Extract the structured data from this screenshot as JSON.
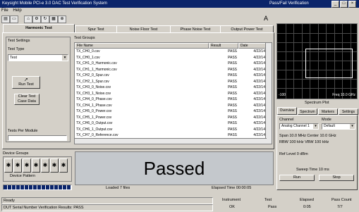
{
  "window": {
    "title": "Keysight Mobile PCI-e 3.0 DAC Test Verification System",
    "right_title": "Pass/Fail Verification"
  },
  "menu": {
    "items": [
      "File",
      "Help"
    ]
  },
  "tabs": [
    "Harmonic Test",
    "Spur Test",
    "Noise Floor Test",
    "Phase Noise Test",
    "Output Power Test"
  ],
  "right_panel": {
    "tab_labels": [
      "Overview",
      "Spectrum",
      "Markers",
      "Settings"
    ],
    "plot_left_label": "-100",
    "plot_right_label": "Freq 10.0 GHz",
    "plot_center_label": "Spectrum Plot"
  },
  "left_panel": {
    "section_label": "Test Settings",
    "type_label": "Test Type",
    "type_value": "Test",
    "run_button": "Run Test",
    "clear_button": "Clear Test Case Data",
    "tests_label": "Tests Per Module",
    "limit_label": "Device Pattern",
    "sub_label": "Test Groups"
  },
  "file_table": {
    "headers": [
      "File Name",
      "Result",
      "Date"
    ],
    "rows": [
      {
        "name": "TX_CH0_0.csv",
        "result": "PASS",
        "date": "4/22/14"
      },
      {
        "name": "TX_CH0_1.csv",
        "result": "PASS",
        "date": "4/22/14"
      },
      {
        "name": "TX_CH1_0_Harmonic.csv",
        "result": "PASS",
        "date": "4/22/14"
      },
      {
        "name": "TX_CH1_1_Harmonic.csv",
        "result": "PASS",
        "date": "4/22/14"
      },
      {
        "name": "TX_CH2_0_Spur.csv",
        "result": "PASS",
        "date": "4/22/14"
      },
      {
        "name": "TX_CH2_1_Spur.csv",
        "result": "PASS",
        "date": "4/22/14"
      },
      {
        "name": "TX_CH3_0_Noise.csv",
        "result": "PASS",
        "date": "4/22/14"
      },
      {
        "name": "TX_CH3_1_Noise.csv",
        "result": "PASS",
        "date": "4/22/14"
      },
      {
        "name": "TX_CH4_0_Phase.csv",
        "result": "PASS",
        "date": "4/22/14"
      },
      {
        "name": "TX_CH4_1_Phase.csv",
        "result": "PASS",
        "date": "4/22/14"
      },
      {
        "name": "TX_CH5_0_Power.csv",
        "result": "PASS",
        "date": "4/22/14"
      },
      {
        "name": "TX_CH5_1_Power.csv",
        "result": "PASS",
        "date": "4/22/14"
      },
      {
        "name": "TX_CH6_0_Output.csv",
        "result": "PASS",
        "date": "4/22/14"
      },
      {
        "name": "TX_CH6_1_Output.csv",
        "result": "PASS",
        "date": "4/22/14"
      },
      {
        "name": "TX_CH7_0_Reference.csv",
        "result": "PASS",
        "date": "4/22/14"
      }
    ]
  },
  "result_banner": "Passed",
  "bottom": {
    "left_group": "Device Groups",
    "progress_label": "Loaded 7 files",
    "elapsed": "Elapsed Time 00:00:05",
    "status_left_top": "Ready",
    "status_left_bottom": "DUT Serial Number Verification Results: PASS",
    "status_mid": "Instrument",
    "status_mid_val": "OK",
    "status_a": "Test",
    "status_a_val": "Pass",
    "status_b": "Elapsed",
    "status_b_val": "0:05",
    "status_c": "Pass Count",
    "status_c_val": "7/7"
  },
  "right_controls": {
    "ch_label": "Channel",
    "ch_value": "Analog Channel 1",
    "mode_label": "Mode",
    "mode_value": "Default",
    "line1": "Span 10.0 MHz    Center 10.0 GHz",
    "line2": "RBW 100 kHz      VBW 100 kHz",
    "line3": "Ref Level 0 dBm",
    "line4": "Sweep Time 10 ms",
    "btn_run": "Run",
    "btn_stop": "Stop"
  }
}
